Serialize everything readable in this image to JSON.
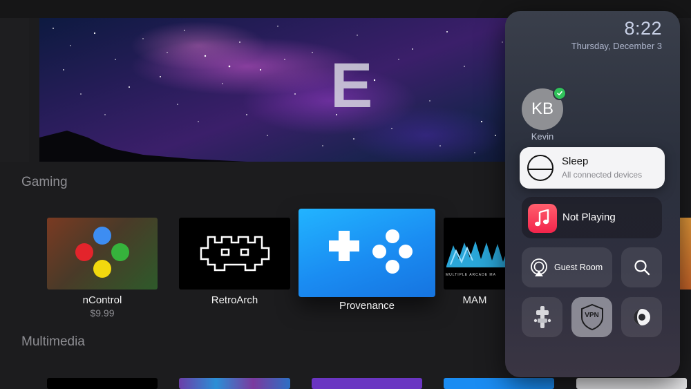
{
  "banner": {
    "letter": "E"
  },
  "sections": {
    "gaming": {
      "title": "Gaming",
      "apps": [
        {
          "label": "nControl",
          "price": "$9.99"
        },
        {
          "label": "RetroArch"
        },
        {
          "label": "Provenance"
        },
        {
          "label": "MAM",
          "banner_text": "MULTIPLE ARCADE MA"
        }
      ]
    },
    "multimedia": {
      "title": "Multimedia"
    }
  },
  "control_center": {
    "time": "8:22",
    "date": "Thursday, December 3",
    "user": {
      "initials": "KB",
      "name": "Kevin",
      "status": "active"
    },
    "sleep": {
      "title": "Sleep",
      "subtitle": "All connected devices"
    },
    "music": {
      "label": "Not Playing"
    },
    "airplay": {
      "label": "Guest Room"
    },
    "vpn": {
      "label": "VPN"
    },
    "icons": [
      "sleep-power-icon",
      "music-app-icon",
      "airplay-audio-icon",
      "search-icon",
      "game-controller-icon",
      "vpn-shield-icon",
      "dark-mode-icon"
    ]
  },
  "colors": {
    "background": "#1c1c1e",
    "accent_green": "#30c25a",
    "music_red": "#f3244b",
    "provenance_blue": "#1a90f5"
  }
}
